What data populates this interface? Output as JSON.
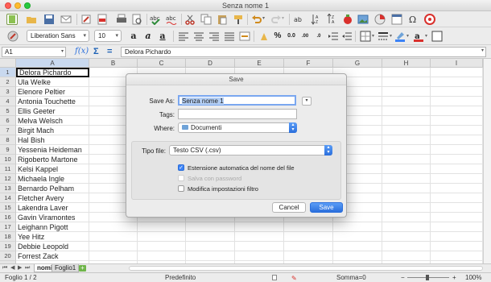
{
  "window": {
    "title": "Senza nome 1"
  },
  "font_bar": {
    "font_name": "Liberation Sans",
    "font_size": "10"
  },
  "formula_bar": {
    "cell_ref": "A1",
    "content": "Delora Pichardo"
  },
  "columns": [
    "A",
    "B",
    "C",
    "D",
    "E",
    "F",
    "G",
    "H",
    "I"
  ],
  "rows": [
    {
      "n": "1",
      "a": "Delora Pichardo"
    },
    {
      "n": "2",
      "a": "Ula Welke"
    },
    {
      "n": "3",
      "a": "Elenore Peltier"
    },
    {
      "n": "4",
      "a": "Antonia Touchette"
    },
    {
      "n": "5",
      "a": "Ellis Geeter"
    },
    {
      "n": "6",
      "a": "Melva Welsch"
    },
    {
      "n": "7",
      "a": "Birgit Mach"
    },
    {
      "n": "8",
      "a": "Hal Bish"
    },
    {
      "n": "9",
      "a": "Yessenia Heideman"
    },
    {
      "n": "10",
      "a": "Rigoberto Martone"
    },
    {
      "n": "11",
      "a": "Kelsi Kappel"
    },
    {
      "n": "12",
      "a": "Michaela Ingle"
    },
    {
      "n": "13",
      "a": "Bernardo Pelham"
    },
    {
      "n": "14",
      "a": "Fletcher Avery"
    },
    {
      "n": "15",
      "a": "Lakendra Laver"
    },
    {
      "n": "16",
      "a": "Gavin Viramontes"
    },
    {
      "n": "17",
      "a": "Leighann Pigott"
    },
    {
      "n": "18",
      "a": "Yee Hitz"
    },
    {
      "n": "19",
      "a": "Debbie Leopold"
    },
    {
      "n": "20",
      "a": "Forrest Zack"
    },
    {
      "n": "21",
      "a": ""
    }
  ],
  "sheet_tabs": {
    "tab1": "nomi",
    "tab2": "Foglio1"
  },
  "status": {
    "sheet": "Foglio 1 / 2",
    "style": "Predefinito",
    "sum": "Somma=0",
    "zoom": "100%"
  },
  "dialog": {
    "title": "Save",
    "save_as_label": "Save As:",
    "save_as_value": "Senza nome 1",
    "tags_label": "Tags:",
    "tags_value": "",
    "where_label": "Where:",
    "where_value": "Documenti",
    "file_type_label": "Tipo file:",
    "file_type_value": "Testo CSV (.csv)",
    "options": [
      {
        "label": "Estensione automatica del nome del file",
        "checked": true,
        "enabled": true
      },
      {
        "label": "Salva con password",
        "checked": false,
        "enabled": false
      },
      {
        "label": "Modifica impostazioni filtro",
        "checked": false,
        "enabled": true
      }
    ],
    "cancel_label": "Cancel",
    "save_label": "Save"
  },
  "colors": {
    "accent": "#3b82f6",
    "selection_header": "#c9d9ef",
    "toolbar_bg": "#ececec"
  }
}
